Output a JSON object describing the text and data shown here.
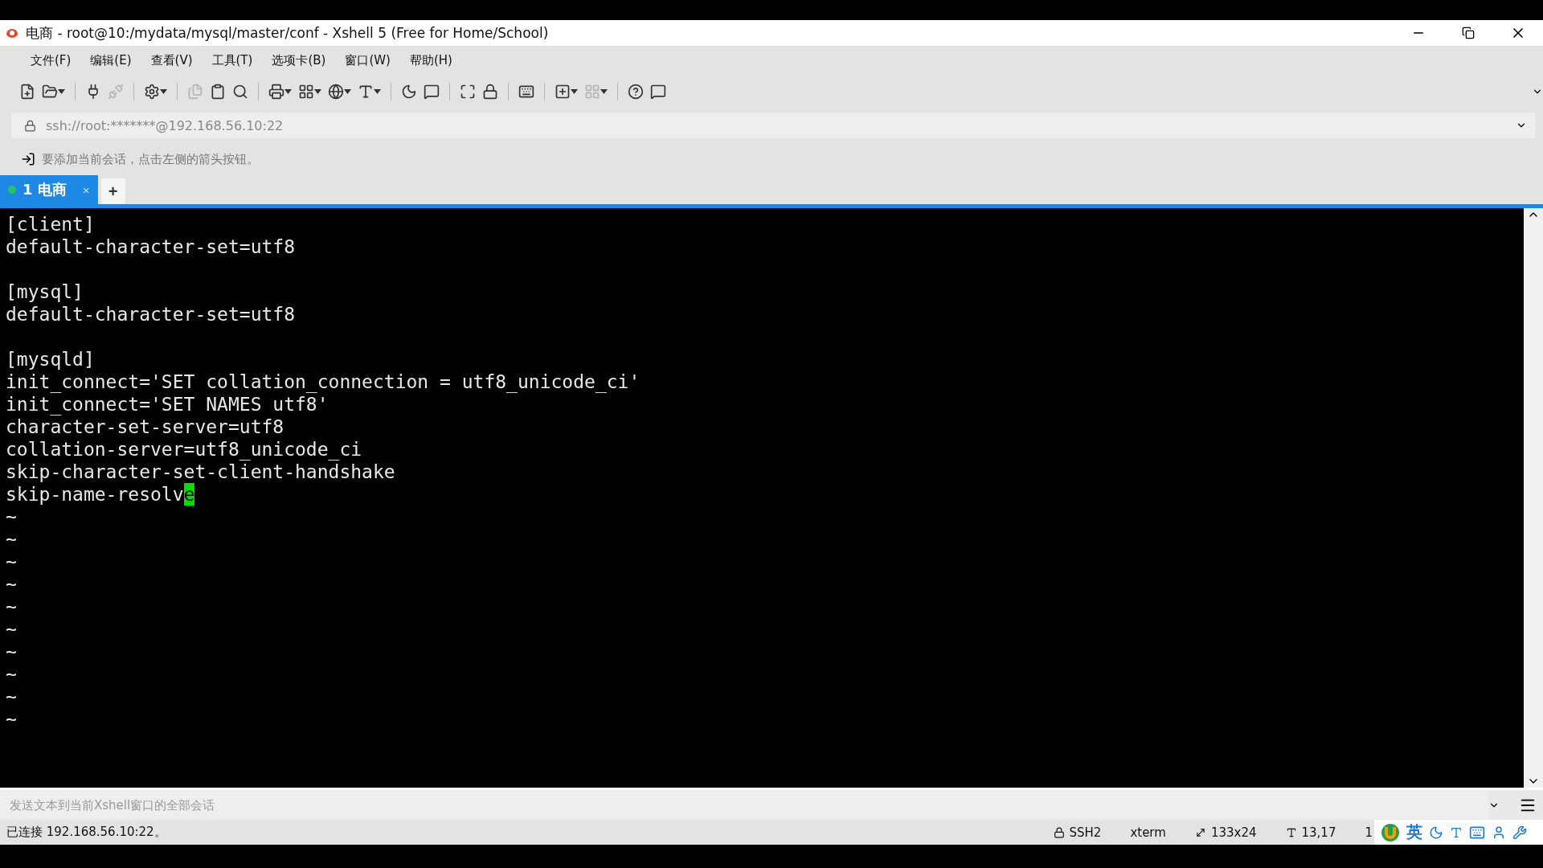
{
  "window": {
    "title": "电商 - root@10:/mydata/mysql/master/conf - Xshell 5 (Free for Home/School)"
  },
  "menu": [
    "文件(F)",
    "编辑(E)",
    "查看(V)",
    "工具(T)",
    "选项卡(B)",
    "窗口(W)",
    "帮助(H)"
  ],
  "address_bar": {
    "value": "ssh://root:*******@192.168.56.10:22"
  },
  "hint_bar": {
    "text": "要添加当前会话，点击左侧的箭头按钮。"
  },
  "tabs": [
    {
      "label": "1 电商",
      "selected": true,
      "color": "#22c55e",
      "close": "×"
    }
  ],
  "new_tab": "+",
  "terminal": {
    "lines": [
      {
        "kind": "text",
        "text": "[client]"
      },
      {
        "kind": "text",
        "text": "default-character-set=utf8"
      },
      {
        "kind": "blank"
      },
      {
        "kind": "text",
        "text": "[mysql]"
      },
      {
        "kind": "text",
        "text": "default-character-set=utf8"
      },
      {
        "kind": "blank"
      },
      {
        "kind": "text",
        "text": "[mysqld]"
      },
      {
        "kind": "text",
        "text": "init_connect='SET collation_connection = utf8_unicode_ci'"
      },
      {
        "kind": "text",
        "text": "init_connect='SET NAMES utf8'"
      },
      {
        "kind": "text",
        "text": "character-set-server=utf8"
      },
      {
        "kind": "text",
        "text": "collation-server=utf8_unicode_ci"
      },
      {
        "kind": "text",
        "text": "skip-character-set-client-handshake"
      },
      {
        "kind": "cursor",
        "text": "skip-name-resolv",
        "cursor": "e"
      },
      {
        "kind": "text",
        "text": "~"
      },
      {
        "kind": "text",
        "text": "~"
      },
      {
        "kind": "text",
        "text": "~"
      },
      {
        "kind": "text",
        "text": "~"
      },
      {
        "kind": "text",
        "text": "~"
      },
      {
        "kind": "text",
        "text": "~"
      },
      {
        "kind": "text",
        "text": "~"
      },
      {
        "kind": "text",
        "text": "~"
      },
      {
        "kind": "text",
        "text": "~"
      },
      {
        "kind": "text",
        "text": "~"
      }
    ]
  },
  "send_bar": {
    "placeholder": "发送文本到当前Xshell窗口的全部会话"
  },
  "status_bar": {
    "connection": "已连接 192.168.56.10:22。",
    "items": [
      {
        "kind": "lock",
        "text": "SSH2"
      },
      {
        "kind": "plain",
        "text": "xterm"
      },
      {
        "kind": "size",
        "text": "133x24"
      },
      {
        "kind": "cursor",
        "text": "13,17"
      },
      {
        "kind": "plain",
        "text": "1"
      }
    ]
  },
  "ime_toolbar": {
    "label": "英"
  }
}
